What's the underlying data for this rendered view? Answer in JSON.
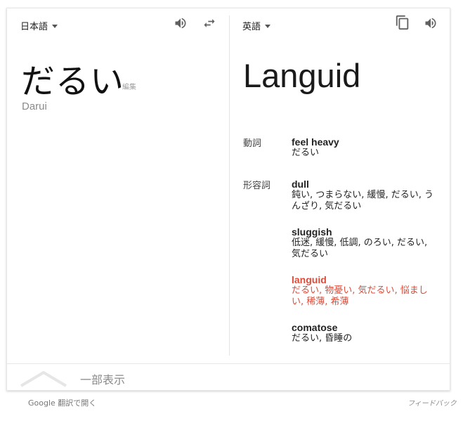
{
  "source": {
    "language": "日本語",
    "text": "だるい",
    "edit_label": "編集",
    "romanization": "Darui"
  },
  "target": {
    "language": "英語",
    "text": "Languid"
  },
  "dictionary": [
    {
      "pos": "動詞",
      "entries": [
        {
          "word": "feel heavy",
          "synonyms": "だるい"
        }
      ]
    },
    {
      "pos": "形容詞",
      "entries": [
        {
          "word": "dull",
          "synonyms_line1": "鈍い, つまらない, 緩慢, だるい, う",
          "synonyms_line2": "んざり, 気だるい"
        },
        {
          "word": "sluggish",
          "synonyms_line1": "低迷, 緩慢, 低調, のろい, だるい,",
          "synonyms_line2": "気だるい"
        },
        {
          "word": "languid",
          "synonyms_line1": "だるい, 物憂い, 気だるい, 悩まし",
          "synonyms_line2": "い, 稀薄, 希薄",
          "highlight": true
        },
        {
          "word": "comatose",
          "synonyms_line1": "だるい, 昏睡の"
        }
      ]
    }
  ],
  "show_less_label": "一部表示",
  "footer": {
    "open_in_translate": "Google 翻訳で開く",
    "feedback": "フィードバック"
  },
  "colors": {
    "highlight": "#dd4b39",
    "icon": "#616161"
  },
  "icons": {
    "source_speaker": "speaker-icon",
    "swap": "swap-arrows-icon",
    "copy": "copy-icon",
    "target_speaker": "speaker-icon",
    "show_less": "chevron-up-icon"
  }
}
